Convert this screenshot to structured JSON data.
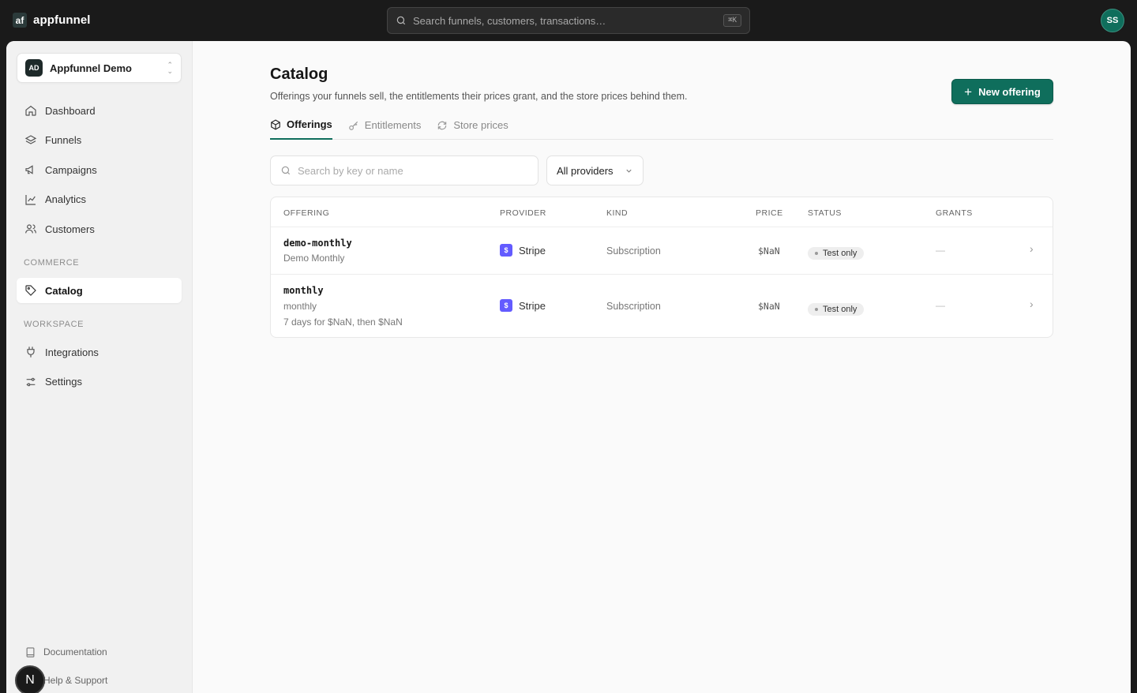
{
  "app": {
    "brand_mark": "af",
    "brand_name": "appfunnel",
    "user_initials": "SS"
  },
  "global_search": {
    "placeholder": "Search funnels, customers, transactions…",
    "shortcut": "⌘K"
  },
  "workspace": {
    "badge": "AD",
    "name": "Appfunnel Demo"
  },
  "sidebar": {
    "items": [
      {
        "label": "Dashboard",
        "icon": "home-icon"
      },
      {
        "label": "Funnels",
        "icon": "layers-icon"
      },
      {
        "label": "Campaigns",
        "icon": "megaphone-icon"
      },
      {
        "label": "Analytics",
        "icon": "chart-line-icon"
      },
      {
        "label": "Customers",
        "icon": "users-icon"
      }
    ],
    "commerce_label": "COMMERCE",
    "commerce_items": [
      {
        "label": "Catalog",
        "icon": "tag-icon",
        "active": true
      }
    ],
    "workspace_label": "WORKSPACE",
    "workspace_items": [
      {
        "label": "Integrations",
        "icon": "plug-icon"
      },
      {
        "label": "Settings",
        "icon": "sliders-icon"
      }
    ],
    "footer": {
      "docs": "Documentation",
      "help": "Help & Support",
      "user_initial": "N"
    }
  },
  "page": {
    "title": "Catalog",
    "subtitle": "Offerings your funnels sell, the entitlements their prices grant, and the store prices behind them.",
    "new_button": "New offering",
    "tabs": [
      {
        "label": "Offerings",
        "active": true
      },
      {
        "label": "Entitlements"
      },
      {
        "label": "Store prices"
      }
    ],
    "search_placeholder": "Search by key or name",
    "provider_filter": "All providers"
  },
  "table": {
    "columns": [
      "OFFERING",
      "PROVIDER",
      "KIND",
      "PRICE",
      "STATUS",
      "GRANTS"
    ],
    "rows": [
      {
        "key": "demo-monthly",
        "name": "Demo Monthly",
        "trial": "",
        "provider": "Stripe",
        "kind": "Subscription",
        "price": "$NaN",
        "status": "Test only",
        "grants": "—"
      },
      {
        "key": "monthly",
        "name": "monthly",
        "trial": "7 days for $NaN, then $NaN",
        "provider": "Stripe",
        "kind": "Subscription",
        "price": "$NaN",
        "status": "Test only",
        "grants": "—"
      }
    ]
  },
  "colors": {
    "accent": "#0f6e5c",
    "stripe": "#635bff",
    "topbar": "#1a1a1a"
  }
}
